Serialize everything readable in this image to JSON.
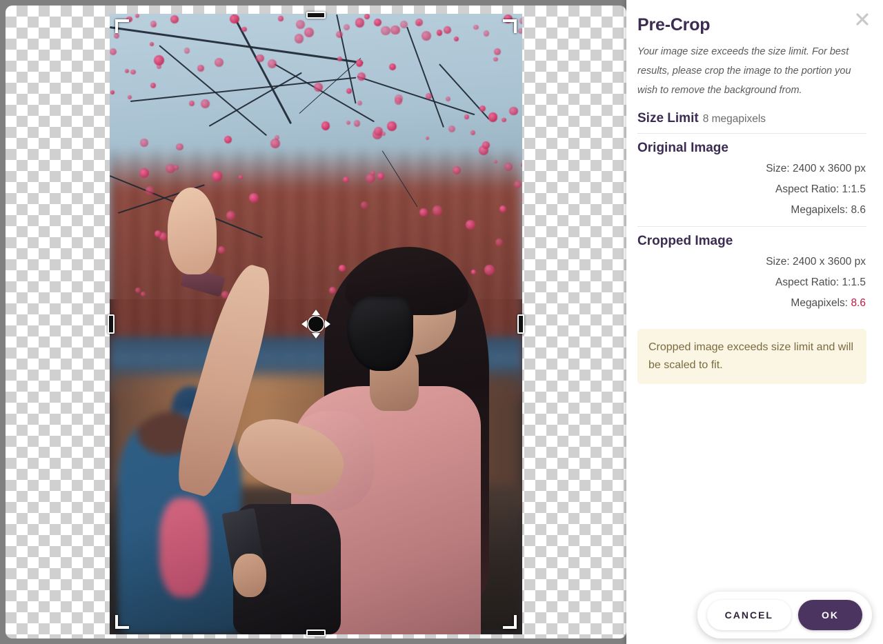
{
  "panel": {
    "title": "Pre-Crop",
    "close_icon": "close-icon",
    "description": "Your image size exceeds the size limit. For best results, please crop the image to the portion you wish to remove the background from.",
    "size_limit": {
      "label": "Size Limit",
      "value": "8 megapixels"
    },
    "original": {
      "heading": "Original Image",
      "rows": [
        {
          "label": "Size:",
          "value": "2400 x 3600 px",
          "alert": false
        },
        {
          "label": "Aspect Ratio:",
          "value": "1:1.5",
          "alert": false
        },
        {
          "label": "Megapixels:",
          "value": "8.6",
          "alert": false
        }
      ]
    },
    "cropped": {
      "heading": "Cropped Image",
      "rows": [
        {
          "label": "Size:",
          "value": "2400 x 3600 px",
          "alert": false
        },
        {
          "label": "Aspect Ratio:",
          "value": "1:1.5",
          "alert": false
        },
        {
          "label": "Megapixels:",
          "value": "8.6",
          "alert": true
        }
      ]
    },
    "warning": "Cropped image exceeds size limit and will be scaled to fit."
  },
  "actions": {
    "cancel_label": "CANCEL",
    "ok_label": "OK"
  },
  "canvas": {
    "name": "crop-canvas",
    "handles": [
      "corner-top-left",
      "corner-top-right",
      "corner-bottom-left",
      "corner-bottom-right",
      "edge-top",
      "edge-bottom",
      "edge-left",
      "edge-right",
      "move-handle"
    ]
  },
  "colors": {
    "accent": "#4b3560",
    "heading": "#3d2c52",
    "alert": "#c4163f",
    "warning_bg": "#fbf6e3",
    "warning_text": "#7a6a3f",
    "panel_bg": "#ffffff",
    "app_bg": "#808080"
  }
}
